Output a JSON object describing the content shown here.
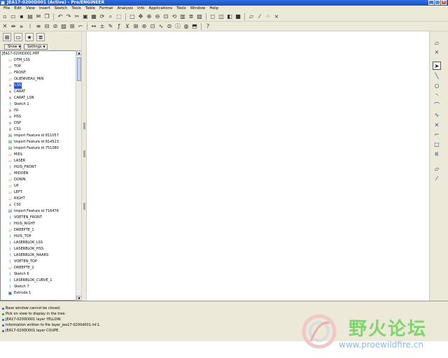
{
  "window": {
    "title": "JEA17-0200D001 (Active) - Pro/ENGINEER",
    "minimize": "_",
    "maximize": "□",
    "close": "×"
  },
  "menu": [
    "File",
    "Edit",
    "View",
    "Insert",
    "Sketch",
    "Tools",
    "Table",
    "Format",
    "Analysis",
    "Info",
    "Applications",
    "Tools",
    "Window",
    "Help"
  ],
  "navigator": {
    "show_label": "Show",
    "settings_label": "Settings"
  },
  "tree": {
    "root": "JEA17-0200D001.PRT",
    "items": [
      {
        "label": "DTM_LSS",
        "icon": "datum-plane-icon",
        "selected": false
      },
      {
        "label": "TOP",
        "icon": "datum-plane-icon",
        "selected": false
      },
      {
        "label": "FRONT",
        "icon": "datum-plane-icon",
        "selected": false
      },
      {
        "label": "OLIENIVEAU_MIN",
        "icon": "datum-plane-icon",
        "selected": false
      },
      {
        "label": "LSS",
        "icon": "csys-icon",
        "selected": true
      },
      {
        "label": "CARAT",
        "icon": "csys-icon",
        "selected": false
      },
      {
        "label": "CARAT_LSN",
        "icon": "csys-icon",
        "selected": false
      },
      {
        "label": "Sketch 1",
        "icon": "sketch-icon",
        "selected": false
      },
      {
        "label": "ISI",
        "icon": "csys-icon",
        "selected": false
      },
      {
        "label": "HSS",
        "icon": "csys-icon",
        "selected": false
      },
      {
        "label": "DSP",
        "icon": "csys-icon",
        "selected": false
      },
      {
        "label": "CS1",
        "icon": "csys-icon",
        "selected": false
      },
      {
        "label": "Import Feature id 811057",
        "icon": "import-feature-icon",
        "selected": false
      },
      {
        "label": "Import Feature id 814523",
        "icon": "import-feature-icon",
        "selected": false
      },
      {
        "label": "Import Feature id 751080",
        "icon": "import-feature-icon",
        "selected": false
      },
      {
        "label": "MIDL",
        "icon": "datum-plane-icon",
        "selected": false
      },
      {
        "label": "LASER",
        "icon": "datum-plane-icon",
        "selected": false
      },
      {
        "label": "HUIS_FRONT",
        "icon": "sketch-icon",
        "selected": false
      },
      {
        "label": "MIDDEN",
        "icon": "datum-plane-icon",
        "selected": false
      },
      {
        "label": "DOWN",
        "icon": "datum-plane-icon",
        "selected": false
      },
      {
        "label": "UP",
        "icon": "datum-plane-icon",
        "selected": false
      },
      {
        "label": "LEFT",
        "icon": "datum-plane-icon",
        "selected": false
      },
      {
        "label": "RIGHT",
        "icon": "datum-plane-icon",
        "selected": false
      },
      {
        "label": "CS0",
        "icon": "csys-icon",
        "selected": false
      },
      {
        "label": "Import Feature id 716476",
        "icon": "import-feature-icon",
        "selected": false
      },
      {
        "label": "VOETEN_FRONT",
        "icon": "sketch-icon",
        "selected": false
      },
      {
        "label": "HUIS_RIGHT",
        "icon": "sketch-icon",
        "selected": false
      },
      {
        "label": "DREEPTE_1",
        "icon": "datum-plane-icon",
        "selected": false
      },
      {
        "label": "HUIS_TOP",
        "icon": "sketch-icon",
        "selected": false
      },
      {
        "label": "LASERBLOK_LSS",
        "icon": "sketch-icon",
        "selected": false
      },
      {
        "label": "LASERBLOK_HSS",
        "icon": "sketch-icon",
        "selected": false
      },
      {
        "label": "LASERBLOK_NAARS",
        "icon": "sketch-icon",
        "selected": false
      },
      {
        "label": "VOETEN_TOP",
        "icon": "sketch-icon",
        "selected": false
      },
      {
        "label": "DREEPTE_2",
        "icon": "datum-plane-icon",
        "selected": false
      },
      {
        "label": "Sketch 6",
        "icon": "sketch-icon",
        "selected": false
      },
      {
        "label": "LASERBLOK_CURVE_1",
        "icon": "sketch-icon",
        "selected": false
      },
      {
        "label": "Sketch 7",
        "icon": "sketch-icon",
        "selected": false
      },
      {
        "label": "Extrude 1",
        "icon": "extrude-icon",
        "selected": false
      }
    ]
  },
  "messages": [
    {
      "text": "Base window cannot be closed.",
      "type": "info"
    },
    {
      "text": "Pick on view to display in the tree.",
      "type": "prompt"
    },
    {
      "text": "JEA17-0200D001 layer YELLOW.",
      "type": "info"
    },
    {
      "text": "Information written to file layer_jea17-0200d001.inf.1.",
      "type": "info"
    },
    {
      "text": "JEA17-0200D001 layer COUPE.",
      "type": "info"
    }
  ],
  "watermark": {
    "title": "野火论坛",
    "url": "www.proewildfire.cn"
  },
  "colors": {
    "title_bar": "#1c4fc4",
    "chrome": "#ece9d8",
    "selection": "#2b55c9",
    "watermark_green": "#7fd46b",
    "watermark_blue": "#8fb8e4"
  }
}
